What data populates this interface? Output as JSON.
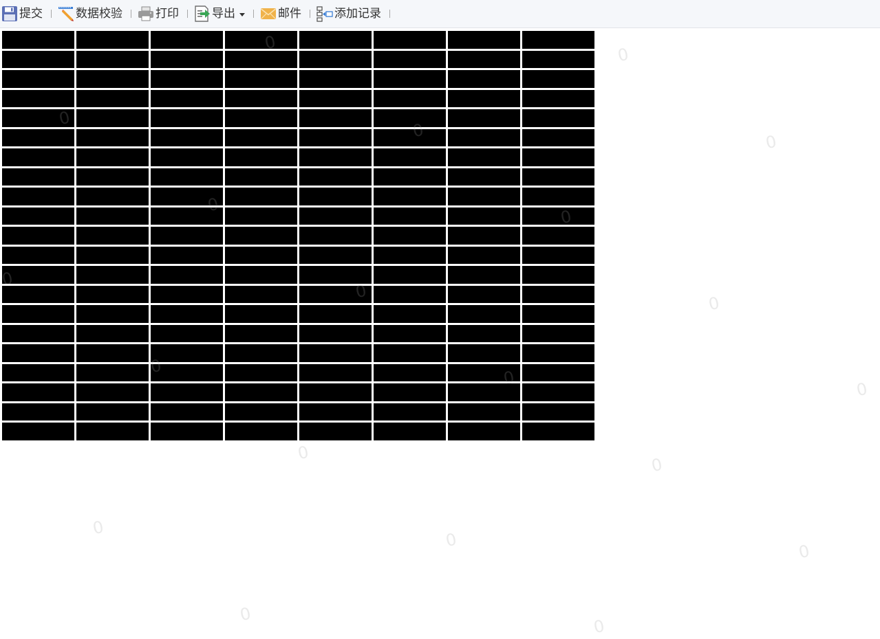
{
  "toolbar": {
    "items": [
      {
        "id": "submit",
        "label": "提交",
        "icon": "floppy-disk-icon"
      },
      {
        "id": "validate",
        "label": "数据校验",
        "icon": "pencil-ruler-icon"
      },
      {
        "id": "print",
        "label": "打印",
        "icon": "printer-icon"
      },
      {
        "id": "export",
        "label": "导出",
        "icon": "export-icon"
      },
      {
        "id": "mail",
        "label": "邮件",
        "icon": "envelope-icon"
      },
      {
        "id": "add_record",
        "label": "添加记录",
        "icon": "add-record-icon"
      }
    ]
  },
  "watermark": {
    "text": "0"
  },
  "grid": {
    "columns": 8,
    "rows": 21,
    "cell_color": "#000000"
  },
  "colors": {
    "toolbar_bg": "#f5f7fa",
    "floppy": "#5b6fb5",
    "export_arrow": "#3aa655",
    "envelope": "#f0b24a"
  }
}
